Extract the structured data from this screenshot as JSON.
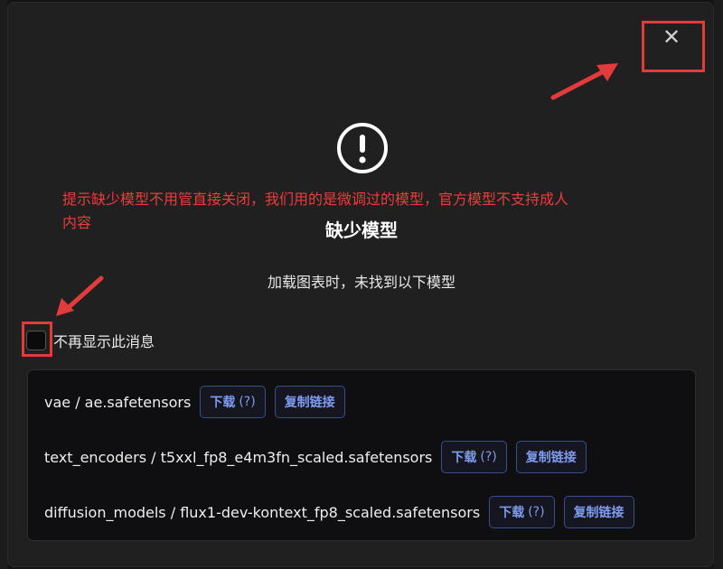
{
  "dialog": {
    "title": "缺少模型",
    "subtitle": "加载图表时，未找到以下模型",
    "close_label": "✕",
    "annotation": "提示缺少模型不用管直接关闭，我们用的是微调过的模型，官方模型不支持成人内容",
    "dont_show_label": "不再显示此消息",
    "models": [
      {
        "name": "vae / ae.safetensors",
        "download_label": "下载",
        "download_hint": "(?)",
        "copy_label": "复制链接"
      },
      {
        "name": "text_encoders / t5xxl_fp8_e4m3fn_scaled.safetensors",
        "download_label": "下载",
        "download_hint": "(?)",
        "copy_label": "复制链接"
      },
      {
        "name": "diffusion_models / flux1-dev-kontext_fp8_scaled.safetensors",
        "download_label": "下载",
        "download_hint": "(?)",
        "copy_label": "复制链接"
      }
    ]
  },
  "colors": {
    "annotation_red": "#e23b3b",
    "button_accent": "#7f9cf0"
  },
  "icons": {
    "warning": "exclamation-circle-icon",
    "close": "close-icon"
  }
}
